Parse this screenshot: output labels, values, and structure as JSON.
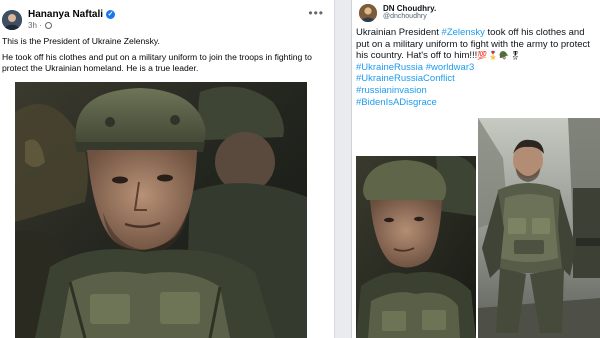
{
  "facebook_post": {
    "author": "Hananya Naftali",
    "verified_icon": "verified-badge-icon",
    "time": "3h",
    "visibility_icon": "globe-icon",
    "more_icon": "more-options-icon",
    "paragraph_1": "This is the President of Ukraine Zelensky.",
    "paragraph_2": "He took off his clothes and put on a military uniform to join the troops in fighting to protect the Ukrainian homeland. He is a true leader.",
    "photo": "soldier-in-helmet-photo",
    "accent_color": "#1877f2"
  },
  "twitter_post": {
    "author": "DN Choudhry.",
    "handle": "@dnchoudhry",
    "text_part_1": "Ukrainian President ",
    "mention_tag": "#Zelensky",
    "text_part_2": " took off his clothes and put on a military uniform to fight with the army to protect his country. Hat's off to him!!!",
    "emojis": "💯🎖️🪖🎖",
    "hashtags": [
      "#UkraineRussia #worldwar3",
      "#UkraineRussiaConflict",
      "#russianinvasion",
      "#BidenIsADisgrace"
    ],
    "photo_left": "soldier-in-helmet-photo",
    "photo_right": "man-in-body-armor-photo",
    "link_color": "#1d9bf0"
  }
}
